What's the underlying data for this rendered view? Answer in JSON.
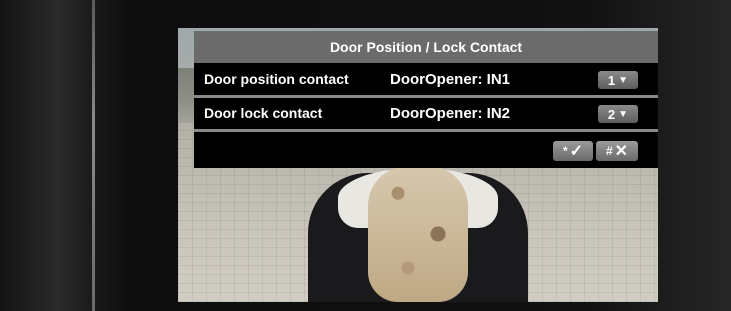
{
  "dialog": {
    "title": "Door Position / Lock Contact",
    "rows": [
      {
        "label": "Door position contact",
        "value": "DoorOpener: IN1",
        "select": "1"
      },
      {
        "label": "Door lock contact",
        "value": "DoorOpener: IN2",
        "select": "2"
      }
    ],
    "select_arrow": "▼"
  },
  "footer": {
    "confirm_key": "*",
    "confirm_symbol": "✓",
    "cancel_key": "#",
    "cancel_symbol": "✕"
  },
  "colors": {
    "title_bar": "#6b6b6b",
    "dialog_bg": "#000000",
    "separator": "#8a8a8a",
    "button": "#7a7a7a",
    "text": "#ffffff"
  }
}
